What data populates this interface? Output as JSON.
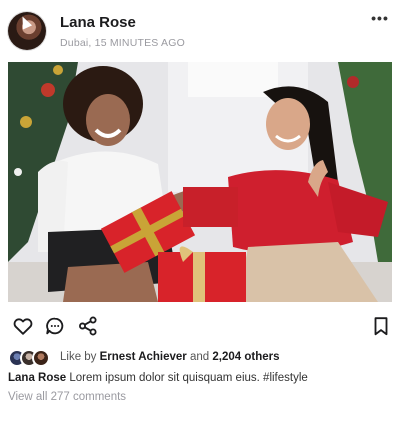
{
  "post": {
    "user": "Lana Rose",
    "location_time": "Dubai, 15 MINUTES AGO",
    "more_icon": "more-horizontal-icon",
    "photo_alt": "Two women exchanging red gift boxes"
  },
  "actions": {
    "like_icon": "heart-icon",
    "comment_icon": "comment-icon",
    "share_icon": "share-icon",
    "save_icon": "bookmark-icon"
  },
  "likes": {
    "prefix": "Like by",
    "name": "Ernest Achiever",
    "connector": "and",
    "others": "2,204 others"
  },
  "caption": {
    "user": "Lana Rose",
    "text": "Lorem ipsum dolor sit quisquam eius. #lifestyle"
  },
  "comments": {
    "label": "View all 277 comments"
  },
  "colors": {
    "text": "#1c1c1e",
    "muted": "#9a9aa0",
    "gift_red": "#d8232a",
    "dress_red": "#cf1f2e"
  }
}
